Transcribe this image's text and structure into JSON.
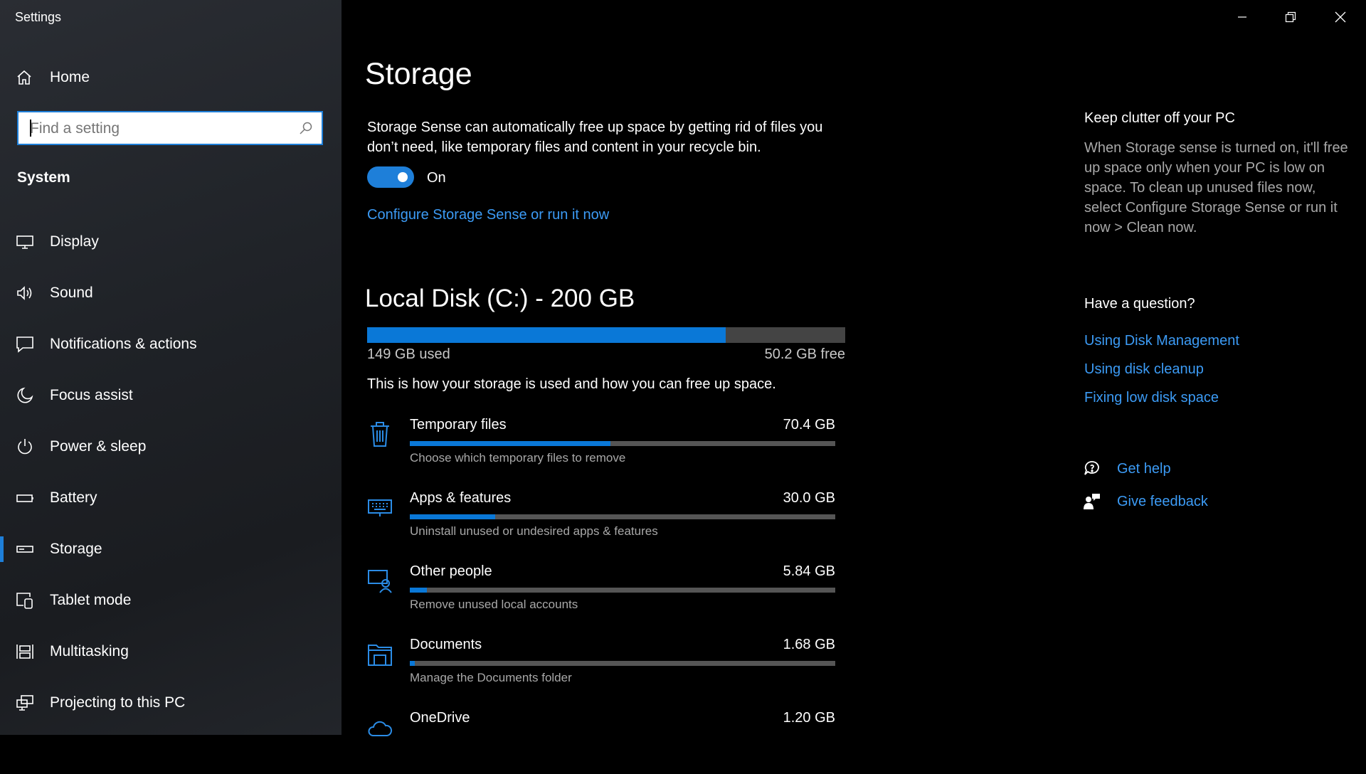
{
  "window": {
    "title": "Settings",
    "controls": {
      "minimize": "minimize",
      "restore": "restore",
      "close": "close"
    }
  },
  "sidebar": {
    "home_label": "Home",
    "search_placeholder": "Find a setting",
    "section_title": "System",
    "items": [
      {
        "label": "Display",
        "icon": "display-icon"
      },
      {
        "label": "Sound",
        "icon": "sound-icon"
      },
      {
        "label": "Notifications & actions",
        "icon": "notifications-icon"
      },
      {
        "label": "Focus assist",
        "icon": "focus-assist-icon"
      },
      {
        "label": "Power & sleep",
        "icon": "power-icon"
      },
      {
        "label": "Battery",
        "icon": "battery-icon"
      },
      {
        "label": "Storage",
        "icon": "storage-icon",
        "active": true
      },
      {
        "label": "Tablet mode",
        "icon": "tablet-mode-icon"
      },
      {
        "label": "Multitasking",
        "icon": "multitasking-icon"
      },
      {
        "label": "Projecting to this PC",
        "icon": "projecting-icon"
      }
    ]
  },
  "main": {
    "title": "Storage",
    "sense_description": "Storage Sense can automatically free up space by getting rid of files you don’t need, like temporary files and content in your recycle bin.",
    "toggle": {
      "state": "On",
      "on": true
    },
    "configure_link": "Configure Storage Sense or run it now",
    "disk": {
      "title": "Local Disk (C:) - 200 GB",
      "used_label": "149 GB used",
      "free_label": "50.2 GB free",
      "used_fraction": 0.75
    },
    "usage_description": "This is how your storage is used and how you can free up space.",
    "categories": [
      {
        "name": "Temporary files",
        "size": "70.4 GB",
        "desc": "Choose which temporary files to remove",
        "fraction": 0.472,
        "icon": "trash-icon"
      },
      {
        "name": "Apps & features",
        "size": "30.0 GB",
        "desc": "Uninstall unused or undesired apps & features",
        "fraction": 0.2,
        "icon": "apps-icon"
      },
      {
        "name": "Other people",
        "size": "5.84 GB",
        "desc": "Remove unused local accounts",
        "fraction": 0.04,
        "icon": "other-people-icon"
      },
      {
        "name": "Documents",
        "size": "1.68 GB",
        "desc": "Manage the Documents folder",
        "fraction": 0.012,
        "icon": "documents-icon"
      },
      {
        "name": "OneDrive",
        "size": "1.20 GB",
        "desc": "",
        "fraction": 0.008,
        "icon": "onedrive-icon"
      }
    ]
  },
  "right": {
    "clutter_title": "Keep clutter off your PC",
    "clutter_text": "When Storage sense is turned on, it'll free up space only when your PC is low on space. To clean up unused files now, select Configure Storage Sense or run it now > Clean now.",
    "question_title": "Have a question?",
    "links": [
      "Using Disk Management",
      "Using disk cleanup",
      "Fixing low disk space"
    ],
    "get_help": "Get help",
    "give_feedback": "Give feedback"
  },
  "colors": {
    "accent": "#0a78d7",
    "link": "#3c9bf5",
    "track": "#444444"
  }
}
